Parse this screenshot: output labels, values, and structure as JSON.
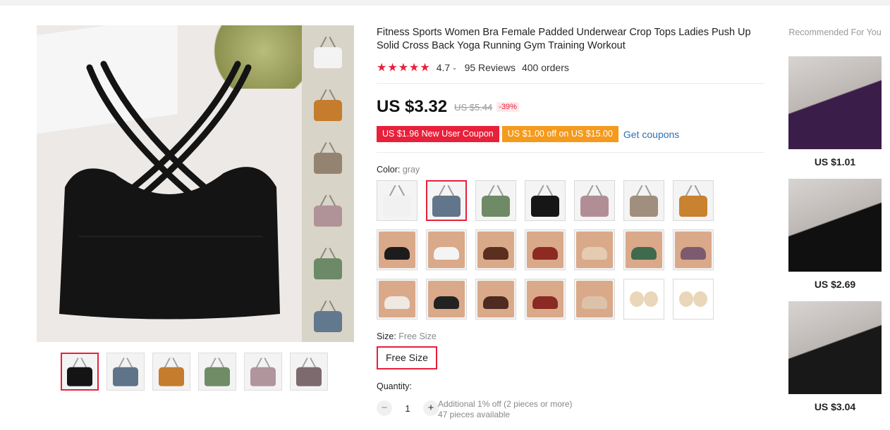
{
  "product": {
    "title": "Fitness Sports Women Bra Female Padded Underwear Crop Tops Ladies Push Up Solid Cross Back Yoga Running Gym Training Workout",
    "rating": "4.7",
    "reviews": "95 Reviews",
    "orders": "400 orders",
    "stars_filled": 5
  },
  "price": {
    "current": "US $3.32",
    "original": "US $5.44",
    "discount": "-39%"
  },
  "coupons": {
    "new_user": "US $1.96 New User Coupon",
    "off": "US $1.00 off on US $15.00",
    "link": "Get coupons"
  },
  "color": {
    "label": "Color:",
    "selected": "gray",
    "options": [
      {
        "name": "white",
        "color": "#f1f1f1",
        "kind": "flat"
      },
      {
        "name": "gray",
        "color": "#62758a",
        "kind": "flat"
      },
      {
        "name": "green",
        "color": "#6f8a66",
        "kind": "flat"
      },
      {
        "name": "black",
        "color": "#161616",
        "kind": "flat"
      },
      {
        "name": "pink",
        "color": "#b18e96",
        "kind": "flat"
      },
      {
        "name": "khaki",
        "color": "#a08f7f",
        "kind": "flat"
      },
      {
        "name": "orange",
        "color": "#c9822f",
        "kind": "flat"
      },
      {
        "name": "model black",
        "color": "#1c1c1c",
        "kind": "model"
      },
      {
        "name": "model white",
        "color": "#f4f4f4",
        "kind": "model"
      },
      {
        "name": "model brown",
        "color": "#5a2f20",
        "kind": "model"
      },
      {
        "name": "model red",
        "color": "#8d2a22",
        "kind": "model"
      },
      {
        "name": "model nude",
        "color": "#e6cbb3",
        "kind": "model"
      },
      {
        "name": "model green",
        "color": "#3f6a4d",
        "kind": "model"
      },
      {
        "name": "model purple",
        "color": "#7d5a6e",
        "kind": "model"
      },
      {
        "name": "back white",
        "color": "#efe9e2",
        "kind": "model"
      },
      {
        "name": "back black",
        "color": "#222222",
        "kind": "model"
      },
      {
        "name": "back brown",
        "color": "#4e2a20",
        "kind": "model"
      },
      {
        "name": "back red",
        "color": "#8a2a22",
        "kind": "model"
      },
      {
        "name": "back nude",
        "color": "#dcc2a8",
        "kind": "model"
      },
      {
        "name": "pad 1",
        "color": "#ead6b8",
        "kind": "pad"
      },
      {
        "name": "pad 2",
        "color": "#ead6b8",
        "kind": "pad"
      }
    ],
    "selected_index": 1
  },
  "size": {
    "label": "Size:",
    "selected": "Free Size",
    "option": "Free Size"
  },
  "quantity": {
    "label": "Quantity:",
    "value": "1",
    "minus": "−",
    "plus": "+",
    "note1": "Additional 1% off (2 pieces or more)",
    "note2": "47 pieces available"
  },
  "gallery": {
    "main_color": "#141414",
    "side_thumbs": [
      "#f3f3f3",
      "#c57c2c",
      "#958371",
      "#b09299",
      "#6c8a68",
      "#61788f"
    ],
    "bottom_thumbs": [
      "#141414",
      "#5f7488",
      "#c57c2c",
      "#6f8c66",
      "#b1959c",
      "#7d6a6e"
    ],
    "active_bottom": 0
  },
  "recommended": {
    "title": "Recommended For You",
    "items": [
      {
        "price": "US $1.01",
        "color": "#3b1d4a"
      },
      {
        "price": "US $2.69",
        "color": "#101010"
      },
      {
        "price": "US $3.04",
        "color": "#181818"
      }
    ]
  },
  "colors": {
    "accent": "#e8203a",
    "coupon_orange": "#f59a1c",
    "link_blue": "#2e6fb7"
  }
}
